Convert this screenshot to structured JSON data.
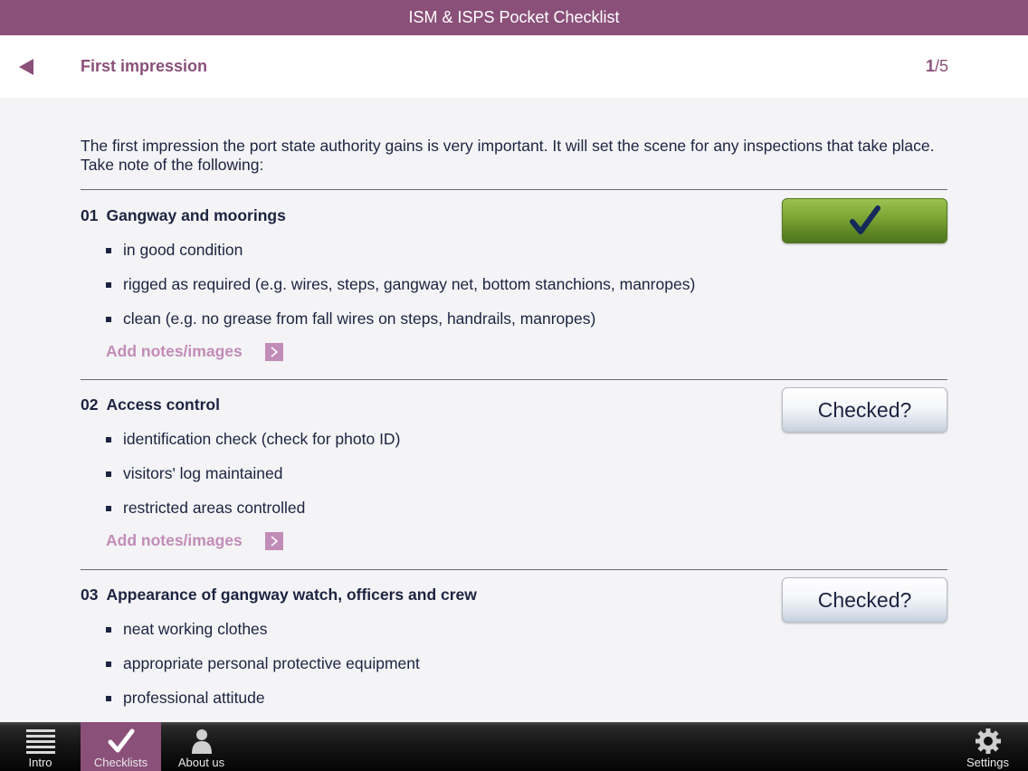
{
  "app": {
    "title": "ISM & ISPS Pocket Checklist"
  },
  "nav": {
    "back_icon": "back-arrow-icon",
    "title": "First impression",
    "page_current": "1",
    "page_total": "/5"
  },
  "intro": "The first impression the port state authority gains is very important. It will set the scene for any inspections that take place. Take note of the following:",
  "sections": [
    {
      "number": "01",
      "title": "Gangway and moorings",
      "items": [
        "in good condition",
        "rigged as required (e.g. wires, steps, gangway net, bottom stanchions, manropes)",
        "clean (e.g. no grease from fall wires on steps, handrails, manropes)"
      ],
      "notes_label": "Add notes/images",
      "checked": true
    },
    {
      "number": "02",
      "title": "Access control",
      "items": [
        "identification check (check for photo ID)",
        "visitors' log maintained",
        "restricted areas controlled"
      ],
      "notes_label": "Add notes/images",
      "checked": false,
      "check_label": "Checked?"
    },
    {
      "number": "03",
      "title": "Appearance of gangway watch, officers and crew",
      "items": [
        "neat working clothes",
        "appropriate personal protective equipment",
        "professional attitude"
      ],
      "checked": false,
      "check_label": "Checked?"
    }
  ],
  "tabs": [
    {
      "label": "Intro",
      "icon": "list-icon",
      "active": false
    },
    {
      "label": "Checklists",
      "icon": "checkmark-icon",
      "active": true
    },
    {
      "label": "About us",
      "icon": "person-icon",
      "active": false
    },
    {
      "label": "Settings",
      "icon": "gear-icon",
      "active": false
    }
  ],
  "colors": {
    "brand": "#8a5079",
    "notes_link": "#c28cb8",
    "checked_green": "#7aa332",
    "text": "#1c2340"
  }
}
